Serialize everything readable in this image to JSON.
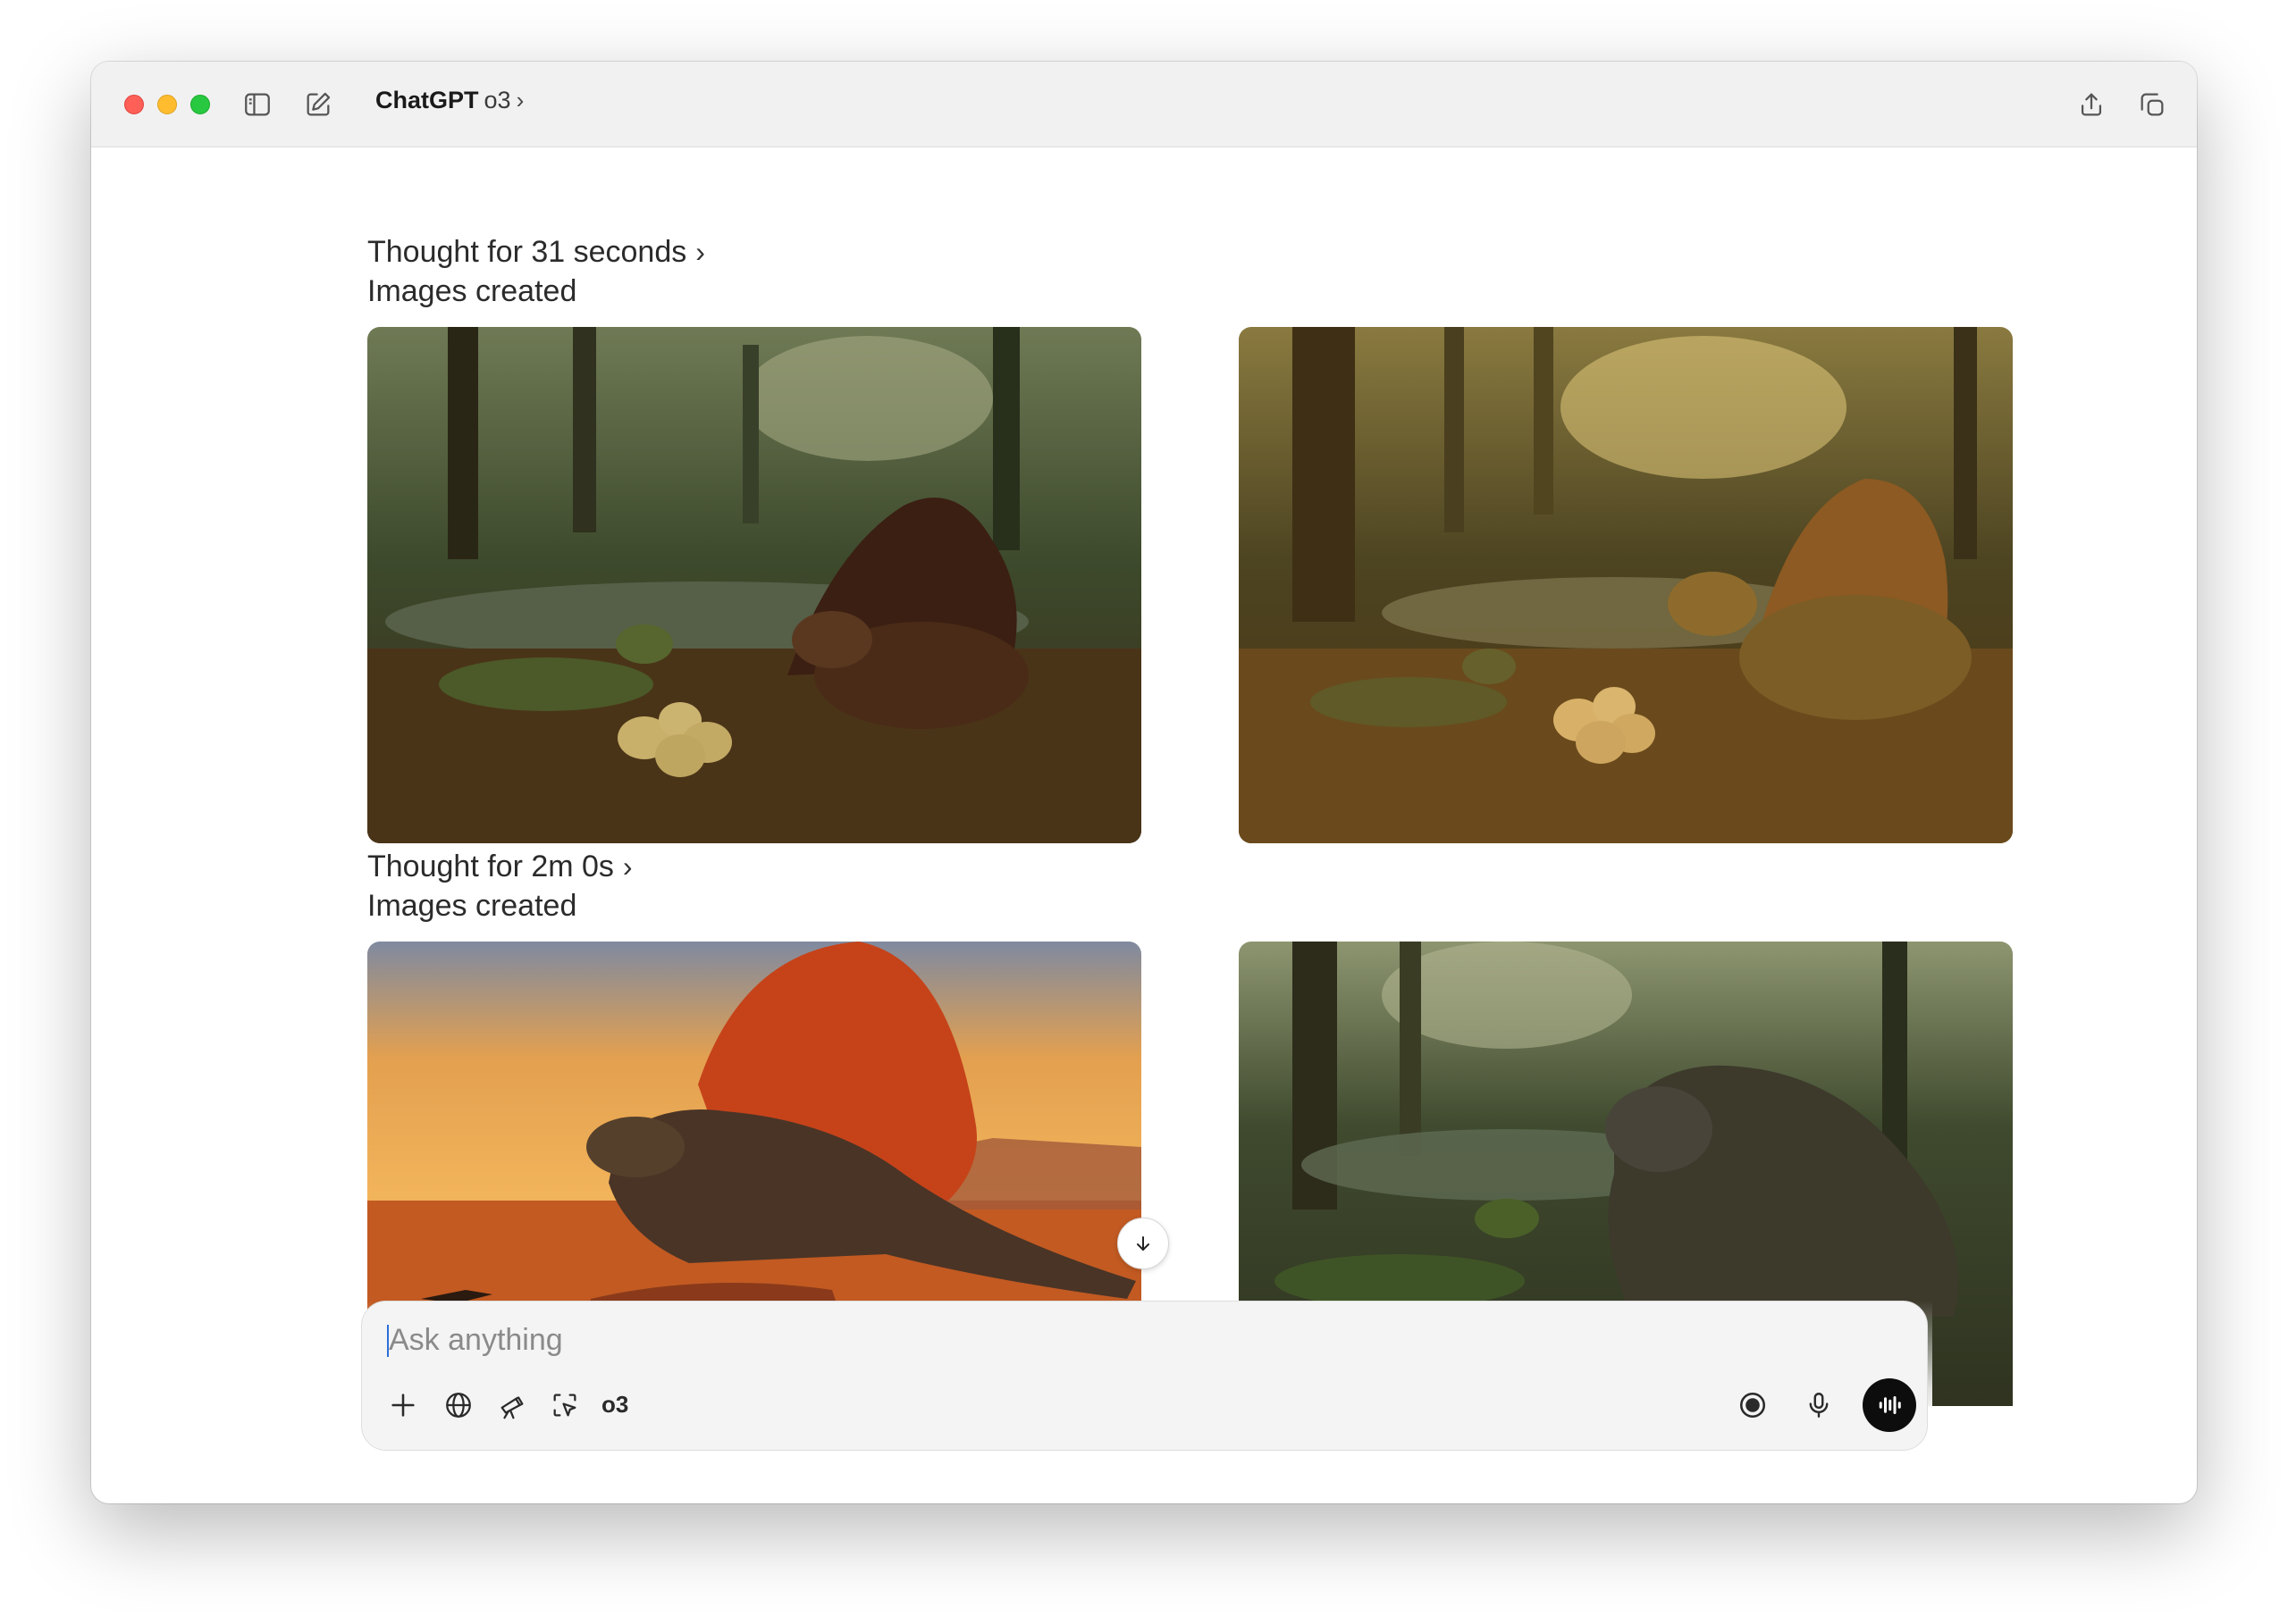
{
  "window": {
    "app_name": "ChatGPT",
    "model": "o3",
    "icons": [
      "sidebar-toggle-icon",
      "new-chat-icon",
      "share-icon",
      "new-window-icon"
    ]
  },
  "messages": [
    {
      "thought": "Thought for 31 seconds",
      "status": "Images created",
      "images": [
        "dimetrodon-forest-eggs-dark",
        "dimetrodon-forest-eggs-golden"
      ]
    },
    {
      "thought": "Thought for 2m 0s",
      "status": "Images created",
      "images": [
        "dimetrodon-desert-sunset",
        "reptile-forest-eggs"
      ]
    }
  ],
  "composer": {
    "placeholder": "Ask anything",
    "model_badge": "o3",
    "tools": [
      "plus-icon",
      "globe-icon",
      "telescope-icon",
      "cursor-select-icon"
    ],
    "right_tools": [
      "record-icon",
      "microphone-icon",
      "voice-mode-icon"
    ]
  },
  "colors": {
    "close": "#fe5f57",
    "minimize": "#febc2e",
    "maximize": "#28c840",
    "voice_button": "#0d0d0d"
  }
}
